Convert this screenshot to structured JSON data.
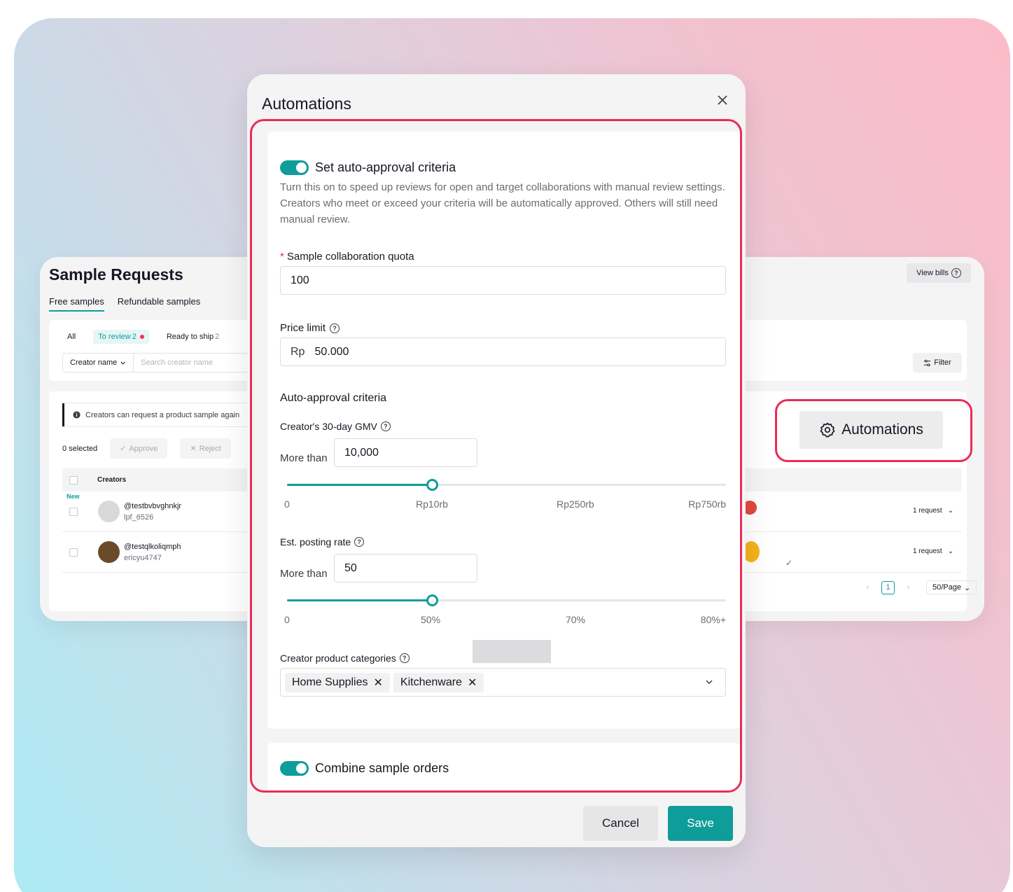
{
  "background_page": {
    "title": "Sample Requests",
    "tabs": [
      {
        "label": "Free samples",
        "active": true
      },
      {
        "label": "Refundable samples",
        "active": false
      }
    ],
    "view_bills_label": "View bills",
    "status_tabs": [
      {
        "label": "All",
        "count": ""
      },
      {
        "label": "To review",
        "count": "2"
      },
      {
        "label": "Ready to ship",
        "count": "2"
      }
    ],
    "search_field": "Creator name",
    "search_placeholder": "Search creator name",
    "filter_label": "Filter",
    "info_banner": "Creators can request a product sample again",
    "selected_label": "0 selected",
    "approve_label": "Approve",
    "reject_label": "Reject",
    "table_header": "Creators",
    "rows": [
      {
        "tag": "New",
        "name": "@testbvbvghnkjr",
        "sub": "lpf_6526",
        "requests": "1 request"
      },
      {
        "tag": "",
        "name": "@testqlkoliqmph",
        "sub": "ericyu4747",
        "requests": "1 request"
      }
    ],
    "pagination": {
      "current": "1",
      "per_page": "50/Page"
    }
  },
  "callout": {
    "label": "Automations",
    "icon": "gear-icon"
  },
  "modal": {
    "title": "Automations",
    "auto_approval": {
      "enabled": true,
      "title": "Set auto-approval criteria",
      "description": "Turn this on to speed up reviews for open and target collaborations with manual review settings. Creators who meet or exceed your criteria will be automatically approved. Others will still need manual review.",
      "quota_label": "Sample collaboration quota",
      "quota_value": "100",
      "price_limit_label": "Price limit",
      "price_prefix": "Rp",
      "price_value": "50.000",
      "criteria_title": "Auto-approval criteria",
      "gmv": {
        "label": "Creator's 30-day GMV",
        "more_than": "More than",
        "value": "10,000",
        "slider_fraction": 0.33,
        "ticks": [
          "0",
          "Rp10rb",
          "Rp250rb",
          "Rp750rb"
        ]
      },
      "posting_rate": {
        "label": "Est. posting rate",
        "more_than": "More than",
        "value": "50",
        "slider_fraction": 0.33,
        "ticks": [
          "0",
          "50%",
          "70%",
          "80%+"
        ]
      },
      "categories_label": "Creator product categories",
      "categories": [
        "Home Supplies",
        "Kitchenware"
      ]
    },
    "combine": {
      "enabled": true,
      "title": "Combine sample orders"
    },
    "cancel_label": "Cancel",
    "save_label": "Save"
  },
  "colors": {
    "accent": "#0f9d9a",
    "highlight": "#ec2b57"
  }
}
